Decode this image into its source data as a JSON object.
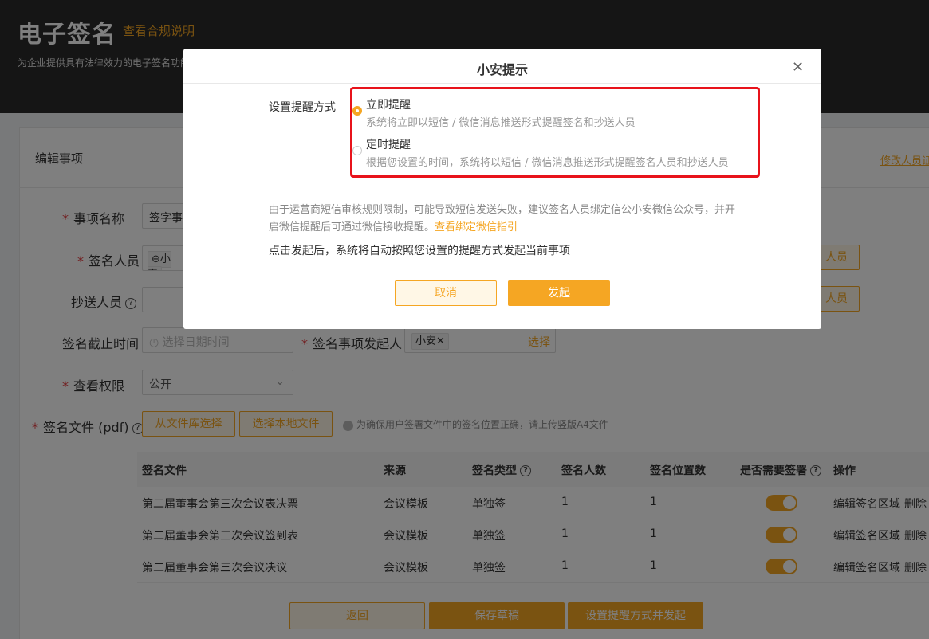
{
  "header": {
    "title": "电子签名",
    "compliance_link": "查看合规说明",
    "subtitle": "为企业提供具有法律效力的电子签名功能"
  },
  "card": {
    "title": "编辑事项",
    "modify_link": "修改人员证"
  },
  "form": {
    "item_name_label": "事项名称",
    "item_name_value": "签字事",
    "signers_label": "签名人员",
    "signer_tag": "小安",
    "signers_button": "人员",
    "cc_label": "抄送人员",
    "cc_button": "人员",
    "deadline_label": "签名截止时间",
    "deadline_placeholder": "选择日期时间",
    "initiator_label": "签名事项发起人",
    "initiator_tag": "小安",
    "initiator_select": "选择",
    "permission_label": "查看权限",
    "permission_value": "公开",
    "file_label": "签名文件 (pdf)",
    "from_library_button": "从文件库选择",
    "local_file_button": "选择本地文件",
    "file_hint": "为确保用户签署文件中的签名位置正确，请上传竖版A4文件"
  },
  "table": {
    "headers": [
      "签名文件",
      "来源",
      "签名类型",
      "签名人数",
      "签名位置数",
      "是否需要签署",
      "操作"
    ],
    "rows": [
      {
        "file": "第二届董事会第三次会议表决票",
        "source": "会议模板",
        "type": "单独签",
        "signers": "1",
        "positions": "1",
        "required": true,
        "edit": "编辑签名区域",
        "delete": "删除"
      },
      {
        "file": "第二届董事会第三次会议签到表",
        "source": "会议模板",
        "type": "单独签",
        "signers": "1",
        "positions": "1",
        "required": true,
        "edit": "编辑签名区域",
        "delete": "删除"
      },
      {
        "file": "第二届董事会第三次会议决议",
        "source": "会议模板",
        "type": "单独签",
        "signers": "1",
        "positions": "1",
        "required": true,
        "edit": "编辑签名区域",
        "delete": "删除"
      }
    ]
  },
  "footer": {
    "back": "返回",
    "save_draft": "保存草稿",
    "set_and_send": "设置提醒方式并发起"
  },
  "modal": {
    "title": "小安提示",
    "close_icon": "close-icon",
    "reminder_label": "设置提醒方式",
    "options": [
      {
        "title": "立即提醒",
        "desc": "系统将立即以短信 / 微信消息推送形式提醒签名和抄送人员",
        "selected": true
      },
      {
        "title": "定时提醒",
        "desc": "根据您设置的时间，系统将以短信 / 微信消息推送形式提醒签名人员和抄送人员",
        "selected": false
      }
    ],
    "notice_part1": "由于运营商短信审核规则限制，可能导致短信发送失败，建议签名人员绑定信公小安微信公众号，并开",
    "notice_part2": "启微信提醒后可通过微信接收提醒。",
    "notice_link": "查看绑定微信指引",
    "info": "点击发起后，系统将自动按照您设置的提醒方式发起当前事项",
    "cancel": "取消",
    "confirm": "发起"
  },
  "colors": {
    "accent": "#f5a623",
    "highlight": "#e8131b",
    "header_bg": "#2a2a2a"
  }
}
